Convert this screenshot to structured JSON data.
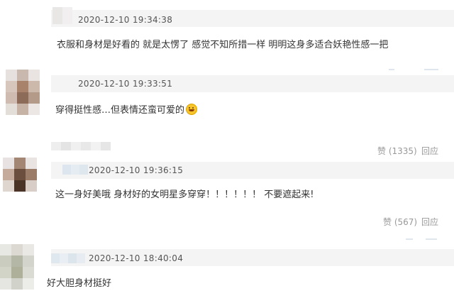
{
  "comments": [
    {
      "timestamp": "2020-12-10 19:34:38",
      "text": "衣服和身材是好看的 就是太愣了 感觉不知所措一样 明明这身多适合妖艳性感一把"
    },
    {
      "timestamp": "2020-12-10 19:33:51",
      "text": "穿得挺性感…但表情还蛮可爱的",
      "emoji": "grinning-face-icon",
      "likes_label": "赞 (1335)",
      "reply_label": "回应"
    },
    {
      "timestamp": "2020-12-10 19:36:15",
      "text": "这一身好美哦 身材好的女明星多穿穿！！！！！！ 不要遮起来!",
      "likes_label": "赞 (567)",
      "reply_label": "回应"
    },
    {
      "timestamp": "2020-12-10 18:40:04",
      "text": "好大胆身材挺好"
    }
  ],
  "colors": {
    "meta_bar": "#f4f4f4",
    "timestamp": "#555555",
    "text": "#333333",
    "action": "#999999"
  }
}
